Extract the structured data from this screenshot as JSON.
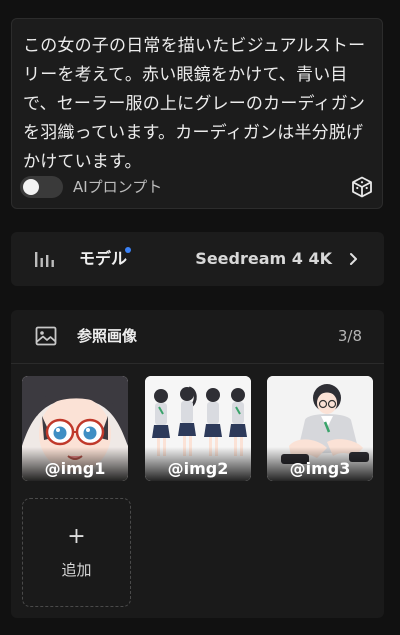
{
  "prompt": {
    "text": "この女の子の日常を描いたビジュアルストーリーを考えて。赤い眼鏡をかけて、青い目で、セーラー服の上にグレーのカーディガンを羽織っています。カーディガンは半分脱げかけています。",
    "ai_prompt_toggle": {
      "label": "AIプロンプト",
      "on": false
    },
    "random_icon": "dice-cube-icon"
  },
  "model": {
    "label": "モデル",
    "value": "Seedream 4 4K",
    "icon": "bar-chart-icon",
    "indicator_color": "#3b82f6"
  },
  "references": {
    "title": "参照画像",
    "count": "3/8",
    "icon": "image-icon",
    "images": [
      {
        "label": "@img1"
      },
      {
        "label": "@img2"
      },
      {
        "label": "@img3"
      }
    ],
    "add_label": "追加",
    "add_glyph": "+"
  }
}
